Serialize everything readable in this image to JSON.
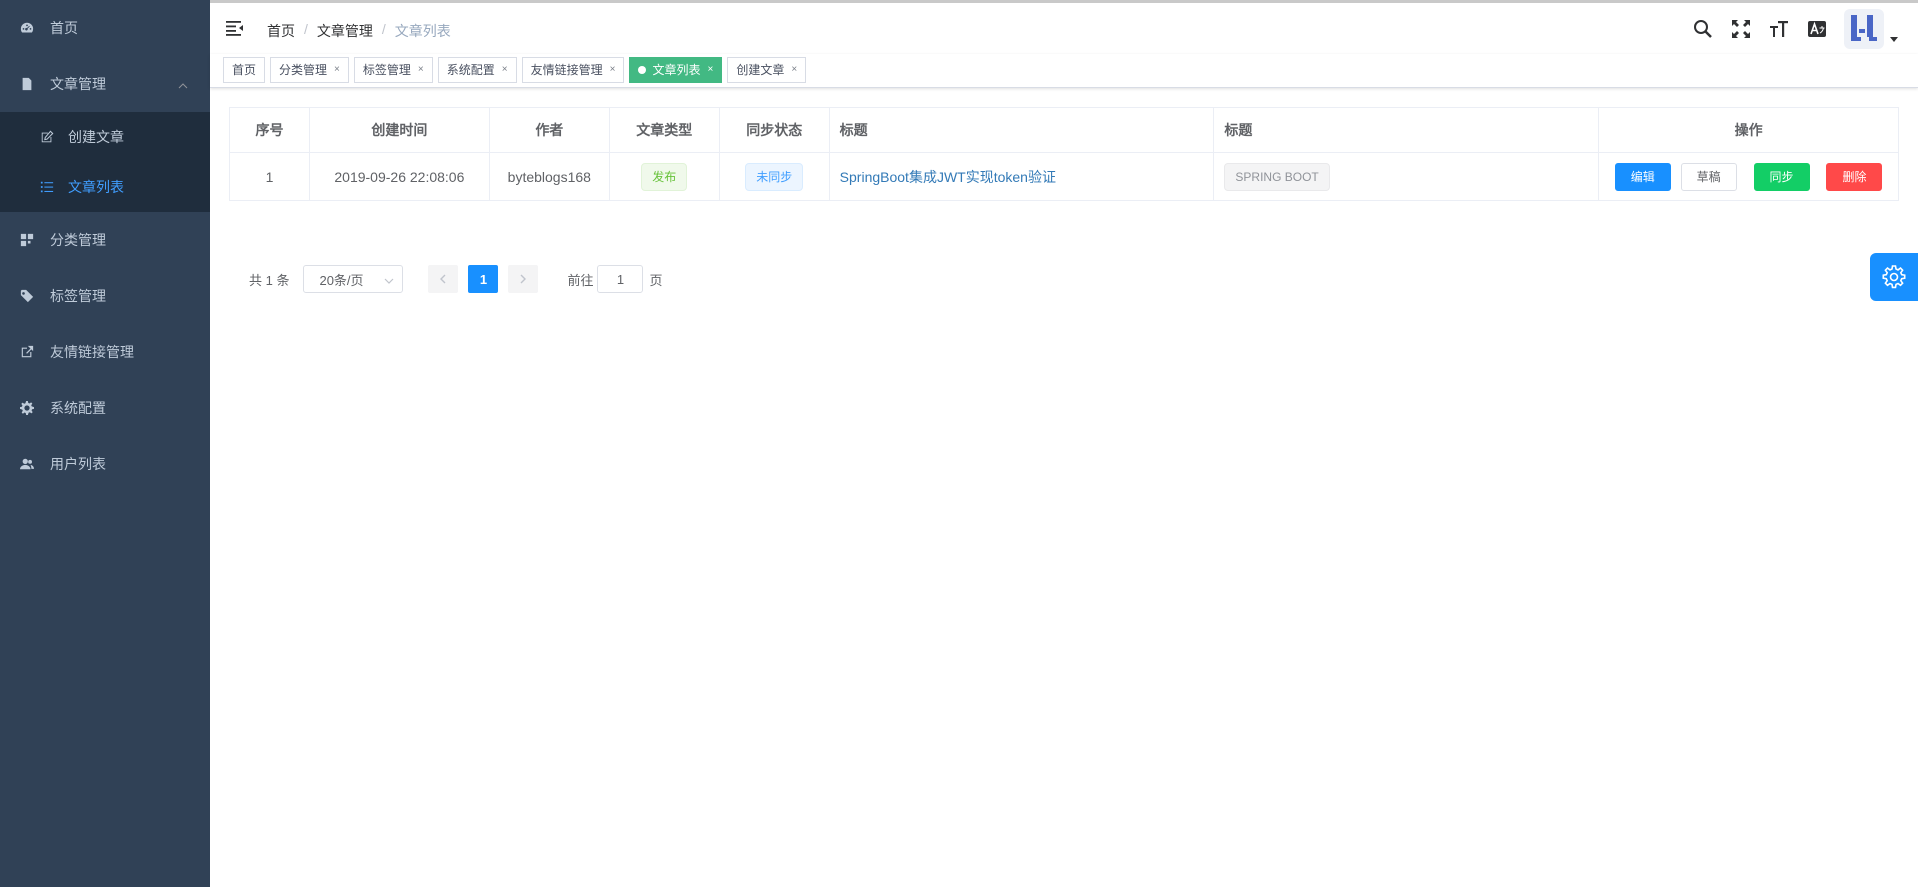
{
  "sidebar": {
    "items": [
      {
        "label": "首页",
        "icon": "dashboard-icon"
      },
      {
        "label": "文章管理",
        "icon": "document-icon",
        "expanded": true,
        "children": [
          {
            "label": "创建文章",
            "icon": "edit-icon"
          },
          {
            "label": "文章列表",
            "icon": "list-icon",
            "active": true
          }
        ]
      },
      {
        "label": "分类管理",
        "icon": "category-icon"
      },
      {
        "label": "标签管理",
        "icon": "tag-icon"
      },
      {
        "label": "友情链接管理",
        "icon": "external-link-icon"
      },
      {
        "label": "系统配置",
        "icon": "gear-icon"
      },
      {
        "label": "用户列表",
        "icon": "users-icon"
      }
    ]
  },
  "breadcrumb": [
    "首页",
    "文章管理",
    "文章列表"
  ],
  "tags": [
    {
      "label": "首页",
      "closable": false
    },
    {
      "label": "分类管理",
      "closable": true
    },
    {
      "label": "标签管理",
      "closable": true
    },
    {
      "label": "系统配置",
      "closable": true
    },
    {
      "label": "友情链接管理",
      "closable": true
    },
    {
      "label": "文章列表",
      "closable": true,
      "active": true
    },
    {
      "label": "创建文章",
      "closable": true
    }
  ],
  "table": {
    "headers": [
      "序号",
      "创建时间",
      "作者",
      "文章类型",
      "同步状态",
      "标题",
      "标题",
      "操作"
    ],
    "rows": [
      {
        "index": "1",
        "created": "2019-09-26 22:08:06",
        "author": "byteblogs168",
        "type": "发布",
        "sync": "未同步",
        "title": "SpringBoot集成JWT实现token验证",
        "tag": "SPRING BOOT",
        "actions": {
          "edit": "编辑",
          "draft": "草稿",
          "sync": "同步",
          "delete": "删除"
        }
      }
    ]
  },
  "pagination": {
    "total": "共 1 条",
    "page_size": "20条/页",
    "current": "1",
    "goto_prefix": "前往",
    "goto_value": "1",
    "goto_suffix": "页"
  },
  "colors": {
    "sidebar_bg": "#304156",
    "submenu_bg": "#1f2d3d",
    "accent": "#1890ff",
    "active_tag": "#42b983"
  }
}
